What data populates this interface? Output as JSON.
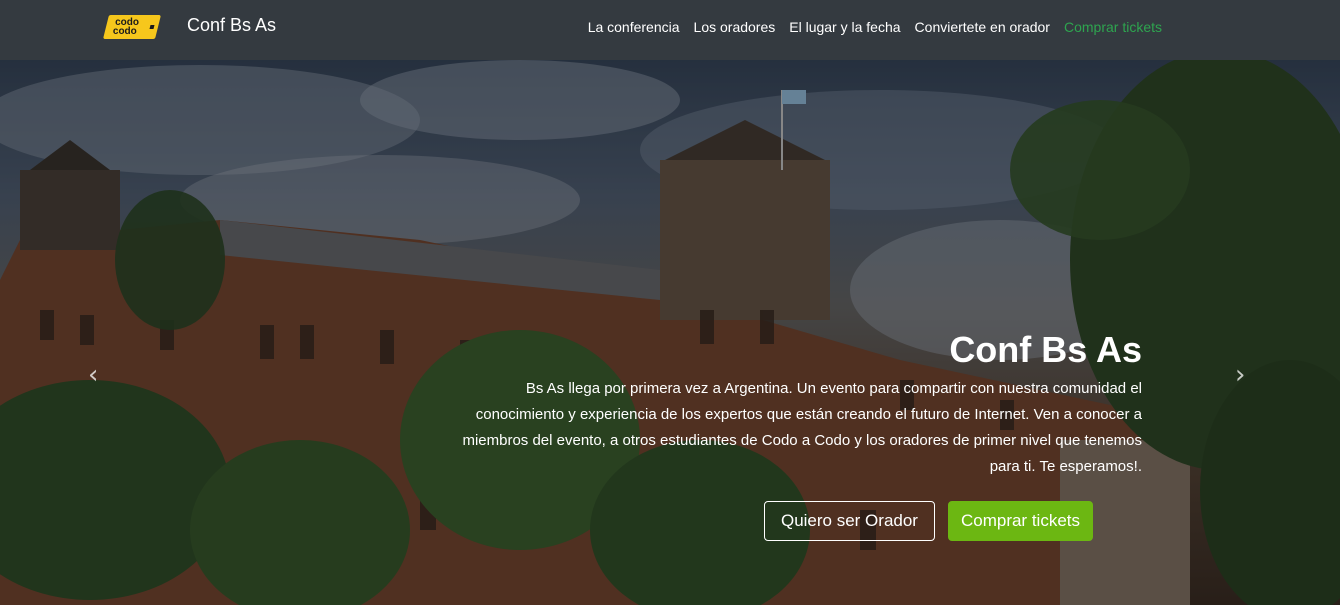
{
  "navbar": {
    "logo_line1": "codo",
    "logo_line2": "codo",
    "brand": "Conf Bs As",
    "links": [
      {
        "label": "La conferencia"
      },
      {
        "label": "Los oradores"
      },
      {
        "label": "El lugar y la fecha"
      },
      {
        "label": "Conviertete en orador"
      },
      {
        "label": "Comprar tickets"
      }
    ],
    "accent_color": "#2ea44f"
  },
  "hero": {
    "title": "Conf Bs As",
    "text": "Bs As llega por primera vez a Argentina. Un evento para compartir con nuestra comunidad el conocimiento y experiencia de los expertos que están creando el futuro de Internet. Ven a conocer a miembros del evento, a otros estudiantes de Codo a Codo y los oradores de primer nivel que tenemos para ti. Te esperamos!.",
    "buttons": {
      "speaker": "Quiero ser Orador",
      "tickets": "Comprar tickets"
    },
    "prev_icon": "‹",
    "next_icon": "›",
    "button_color": "#6cb712"
  }
}
